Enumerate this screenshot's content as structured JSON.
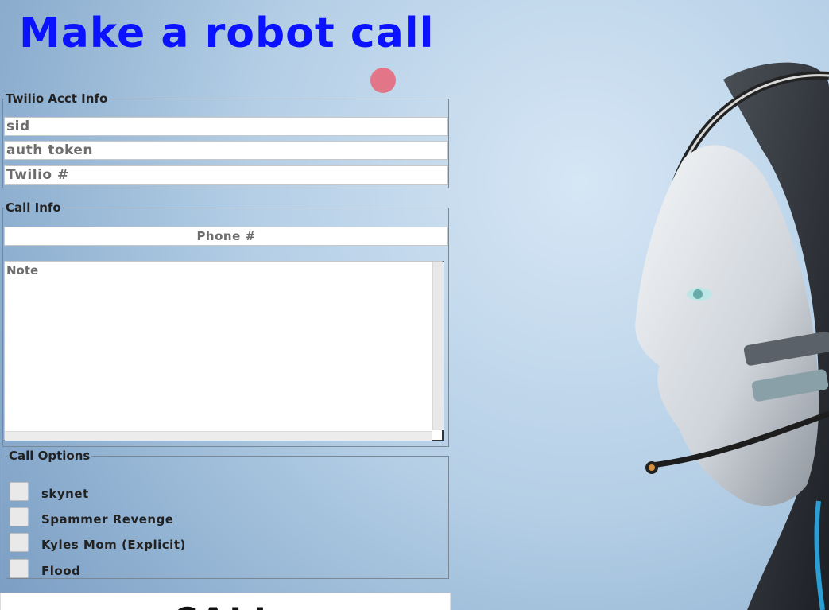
{
  "page": {
    "title": "Make a robot call"
  },
  "acct_info": {
    "legend": "Twilio Acct Info",
    "sid_placeholder": "sid",
    "token_placeholder": "auth token",
    "twilio_number_placeholder": "Twilio #"
  },
  "call_info": {
    "legend": "Call Info",
    "phone_placeholder": "Phone #",
    "note_placeholder": "Note"
  },
  "call_options": {
    "legend": "Call Options",
    "options": [
      {
        "label": "skynet",
        "checked": false
      },
      {
        "label": "Spammer Revenge",
        "checked": false
      },
      {
        "label": "Kyles Mom (Explicit)",
        "checked": false
      },
      {
        "label": "Flood",
        "checked": false
      }
    ]
  },
  "actions": {
    "call_label": "CALL"
  },
  "colors": {
    "title": "#0a12ff",
    "accent_dot": "#e66c7d",
    "background": "#b5cfe6"
  },
  "icons": {
    "background_image": "robot-headset-image",
    "indicator": "status-dot-icon"
  }
}
